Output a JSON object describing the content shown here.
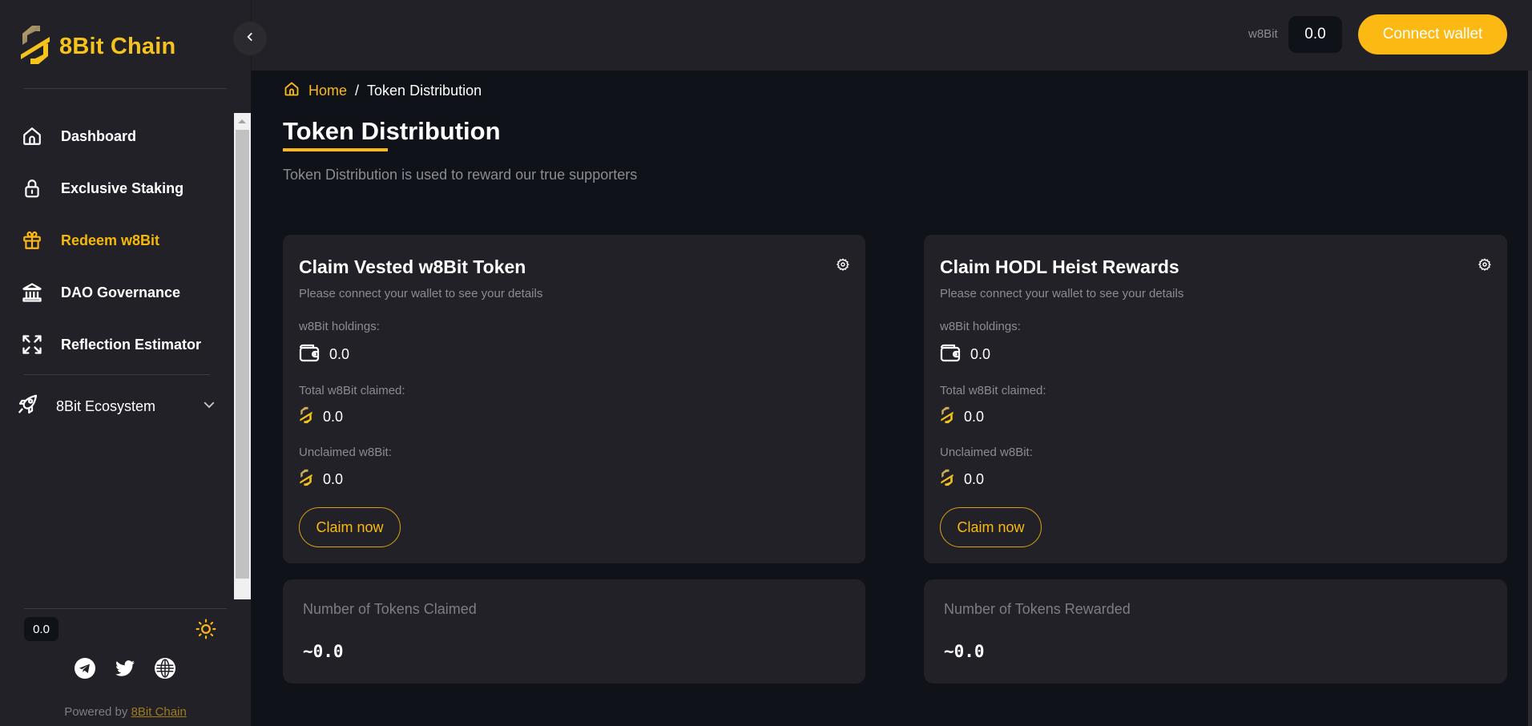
{
  "brand": {
    "name": "8Bit Chain",
    "accent": "#fdb913"
  },
  "sidebar": {
    "items": [
      {
        "label": "Dashboard",
        "icon": "home-icon",
        "active": false
      },
      {
        "label": "Exclusive Staking",
        "icon": "lock-icon",
        "active": false
      },
      {
        "label": "Redeem w8Bit",
        "icon": "gift-icon",
        "active": true
      },
      {
        "label": "DAO Governance",
        "icon": "bank-icon",
        "active": false
      },
      {
        "label": "Reflection Estimator",
        "icon": "arrows-expand-icon",
        "active": false
      }
    ],
    "ecosystem": {
      "label": "8Bit Ecosystem",
      "icon": "rocket-icon"
    },
    "footer": {
      "balance": "0.0",
      "powered_prefix": "Powered by ",
      "powered_link": "8Bit Chain",
      "socials": [
        "telegram-icon",
        "twitter-icon",
        "globe-icon"
      ]
    }
  },
  "header": {
    "unit": "w8Bit",
    "balance": "0.0",
    "connect_label": "Connect wallet"
  },
  "breadcrumb": {
    "home": "Home",
    "separator": "/",
    "current": "Token Distribution"
  },
  "page": {
    "title": "Token Distribution",
    "subtitle": "Token Distribution is used to reward our true supporters"
  },
  "cards": [
    {
      "title": "Claim Vested w8Bit Token",
      "note": "Please connect your wallet to see your details",
      "holdings_label": "w8Bit holdings:",
      "holdings_value": "0.0",
      "claimed_label": "Total w8Bit claimed:",
      "claimed_value": "0.0",
      "unclaimed_label": "Unclaimed w8Bit:",
      "unclaimed_value": "0.0",
      "claim_label": "Claim now"
    },
    {
      "title": "Claim HODL Heist Rewards",
      "note": "Please connect your wallet to see your details",
      "holdings_label": "w8Bit holdings:",
      "holdings_value": "0.0",
      "claimed_label": "Total w8Bit claimed:",
      "claimed_value": "0.0",
      "unclaimed_label": "Unclaimed w8Bit:",
      "unclaimed_value": "0.0",
      "claim_label": "Claim now"
    }
  ],
  "stats": [
    {
      "label": "Number of Tokens Claimed",
      "value": "~0.0"
    },
    {
      "label": "Number of Tokens Rewarded",
      "value": "~0.0"
    }
  ]
}
